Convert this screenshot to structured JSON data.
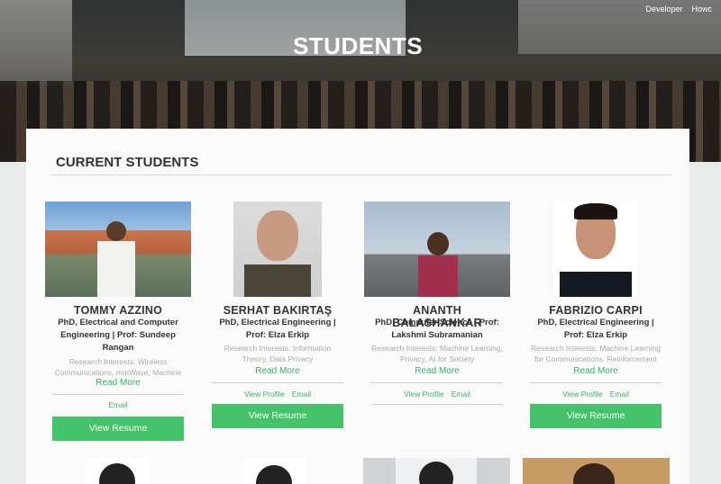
{
  "nav": {
    "items": [
      "Developer",
      "Howc"
    ]
  },
  "hero": {
    "title": "STUDENTS"
  },
  "section": {
    "title": "CURRENT STUDENTS"
  },
  "students": [
    {
      "name": "TOMMY AZZINO",
      "degree": "PhD, Electrical and Computer Engineering | Prof: Sundeep Rangan",
      "interests": "Research Interests: Wireless Communications, mmWave, Machine",
      "read_more": "Read More",
      "links": [
        "Email"
      ],
      "button": "View Resume"
    },
    {
      "name": "SERHAT BAKIRTAŞ",
      "degree": "PhD, Electrical Engineering | Prof: Elza Erkip",
      "interests": "Research Interests: Information Theory, Data Privacy",
      "read_more": "Read More",
      "links": [
        "View Profile",
        "Email"
      ],
      "button": "View Resume"
    },
    {
      "name": "ANANTH BALASHANKAR",
      "degree": "PhD, Computer Science | Prof: Lakshmi Subramanian",
      "interests": "Research Interests: Machine Learning, Privacy, AI for Society",
      "read_more": "Read More",
      "links": [
        "View Profile",
        "Email"
      ],
      "button": ""
    },
    {
      "name": "FABRIZIO CARPI",
      "degree": "PhD, Electrical Engineering | Prof: Elza Erkip",
      "interests": "Research Interests: Machine Learning for Communications, Reinforcement",
      "read_more": "Read More",
      "links": [
        "View Profile",
        "Email"
      ],
      "button": "View Resume"
    }
  ]
}
